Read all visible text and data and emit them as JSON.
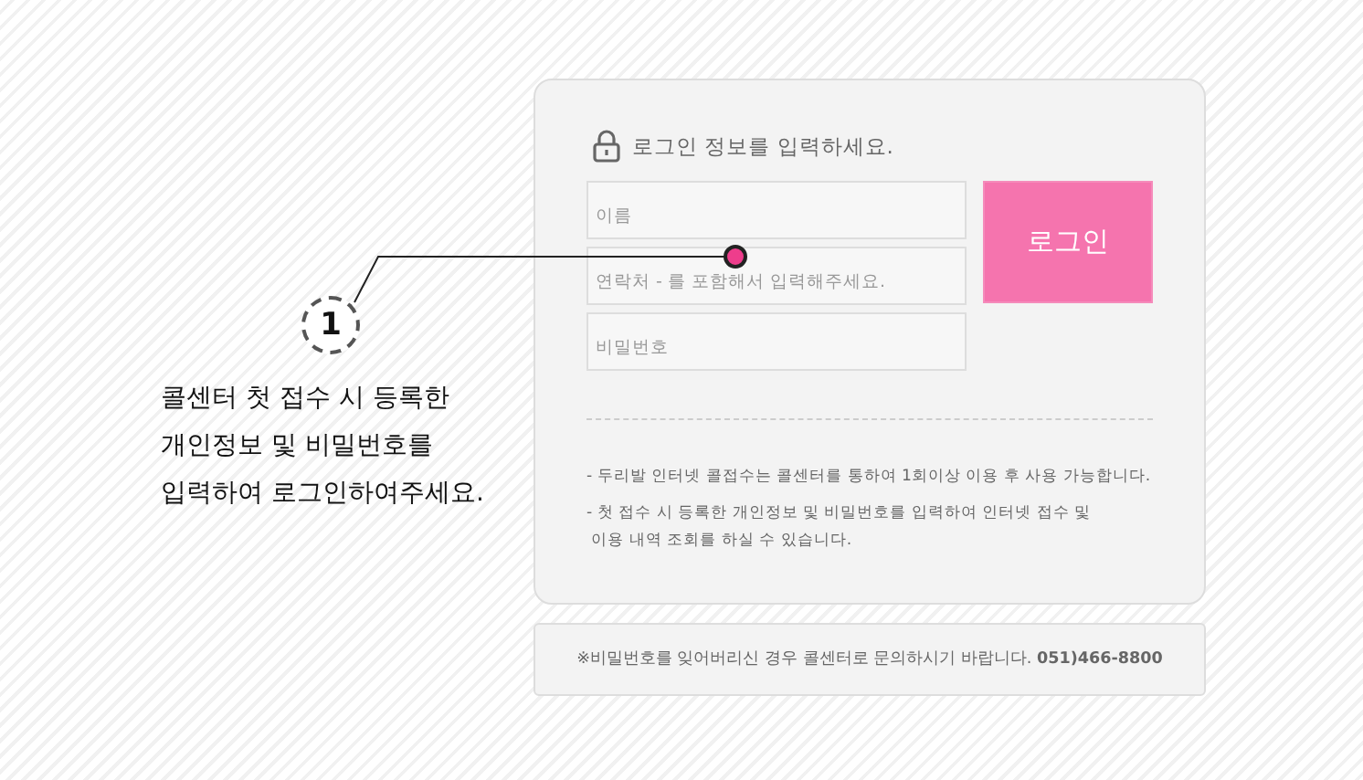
{
  "annotation": {
    "number": "1",
    "lines": [
      "콜센터 첫 접수 시 등록한",
      "개인정보 및 비밀번호를",
      "입력하여 로그인하여주세요."
    ]
  },
  "login": {
    "title": "로그인 정보를 입력하세요.",
    "fields": [
      {
        "placeholder": "이름"
      },
      {
        "placeholder": "연락처 - 를 포함해서 입력해주세요."
      },
      {
        "placeholder": "비밀번호"
      }
    ],
    "button": "로그인",
    "notes": [
      "- 두리발 인터넷 콜접수는 콜센터를 통하여 1회이상 이용 후 사용 가능합니다.",
      "- 첫 접수 시 등록한 개인정보 및 비밀번호를 입력하여 인터넷 접수 및\n 이용 내역 조회를 하실 수 있습니다."
    ]
  },
  "footer": "※비밀번호를 잊어버리신 경우 콜센터로 문의하시기 바랍니다. **051)466-8800**"
}
